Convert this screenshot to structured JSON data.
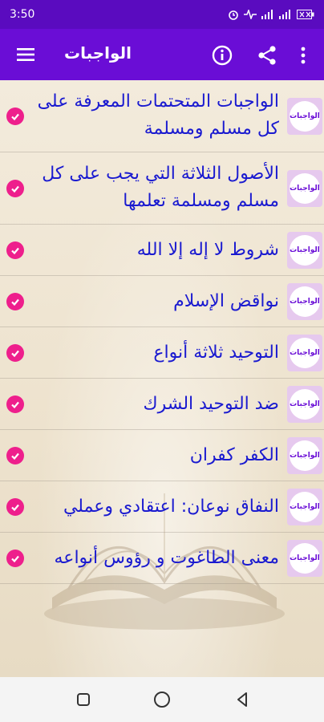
{
  "status_bar": {
    "time": "3:50"
  },
  "app_bar": {
    "title": "الواجبات"
  },
  "list": {
    "items": [
      {
        "label": "الواجبات المتحتمات المعرفة على كل مسلم ومسلمة",
        "thumb": "الواجبات"
      },
      {
        "label": "الأصول الثلاثة التي يجب على كل مسلم ومسلمة تعلمها",
        "thumb": "الواجبات"
      },
      {
        "label": "شروط لا إله إلا الله",
        "thumb": "الواجبات"
      },
      {
        "label": "نواقض الإسلام",
        "thumb": "الواجبات"
      },
      {
        "label": "التوحيد ثلاثة أنواع",
        "thumb": "الواجبات"
      },
      {
        "label": "ضد التوحيد الشرك",
        "thumb": "الواجبات"
      },
      {
        "label": "الكفر كفران",
        "thumb": "الواجبات"
      },
      {
        "label": "النفاق نوعان: اعتقادي وعملي",
        "thumb": "الواجبات"
      },
      {
        "label": "معنى الطاغوت و رؤوس أنواعه",
        "thumb": "الواجبات"
      }
    ]
  },
  "colors": {
    "status_bar": "#5a0bbf",
    "app_bar": "#6a0dd6",
    "check": "#ee1f8c",
    "label_text": "#1a1ad0"
  },
  "icons": {
    "menu": "menu-icon",
    "info": "info-icon",
    "share": "share-icon",
    "more": "more-vertical-icon",
    "check": "check-circle-icon",
    "nav_recents": "square-icon",
    "nav_home": "circle-icon",
    "nav_back": "triangle-back-icon"
  }
}
